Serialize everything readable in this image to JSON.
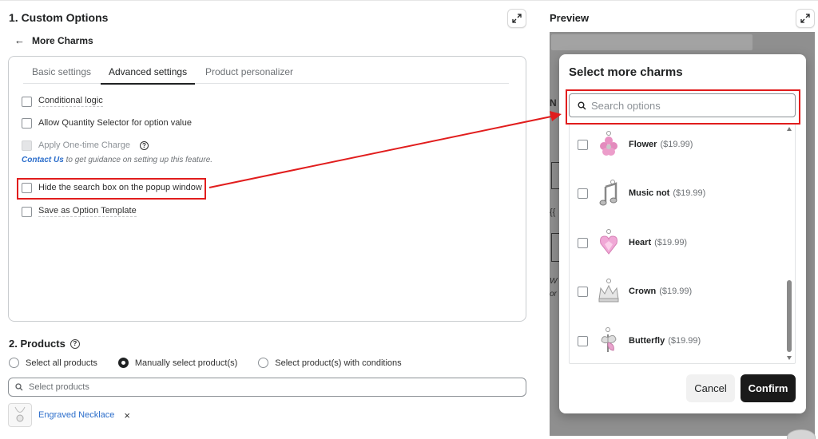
{
  "left": {
    "section_title": "1. Custom Options",
    "back_label": "More Charms",
    "back_arrow": "←",
    "tabs": [
      {
        "label": "Basic settings"
      },
      {
        "label": "Advanced settings"
      },
      {
        "label": "Product personalizer"
      }
    ],
    "options": {
      "conditional_logic": "Conditional logic",
      "qty_selector": "Allow Quantity Selector for option value",
      "one_time_charge": "Apply One-time Charge",
      "hide_search": "Hide the search box on the popup window",
      "save_template": "Save as Option Template"
    },
    "help_glyph": "?",
    "guide": {
      "link": "Contact Us",
      "text": " to get guidance on setting up this feature."
    }
  },
  "products": {
    "title": "2. Products",
    "radios": {
      "all": "Select all products",
      "manual": "Manually select product(s)",
      "conditions": "Select product(s) with conditions"
    },
    "search_placeholder": "Select products",
    "selected": {
      "name": "Engraved Necklace",
      "remove": "×"
    }
  },
  "preview": {
    "title": "Preview",
    "bg_letter": "N",
    "bg_brace": "{{",
    "bg_letter_w": "W",
    "bg_letter_o": "or",
    "modal": {
      "title": "Select more charms",
      "search_placeholder": "Search options",
      "items": [
        {
          "name": "Flower",
          "price": "($19.99)"
        },
        {
          "name": "Music not",
          "price": "($19.99)"
        },
        {
          "name": "Heart",
          "price": "($19.99)"
        },
        {
          "name": "Crown",
          "price": "($19.99)"
        },
        {
          "name": "Butterfly",
          "price": "($19.99)"
        }
      ],
      "cancel": "Cancel",
      "confirm": "Confirm"
    }
  },
  "colors": {
    "highlight": "#e11d1d",
    "link": "#2c6ecb",
    "confirm_bg": "#1a1a1a"
  }
}
